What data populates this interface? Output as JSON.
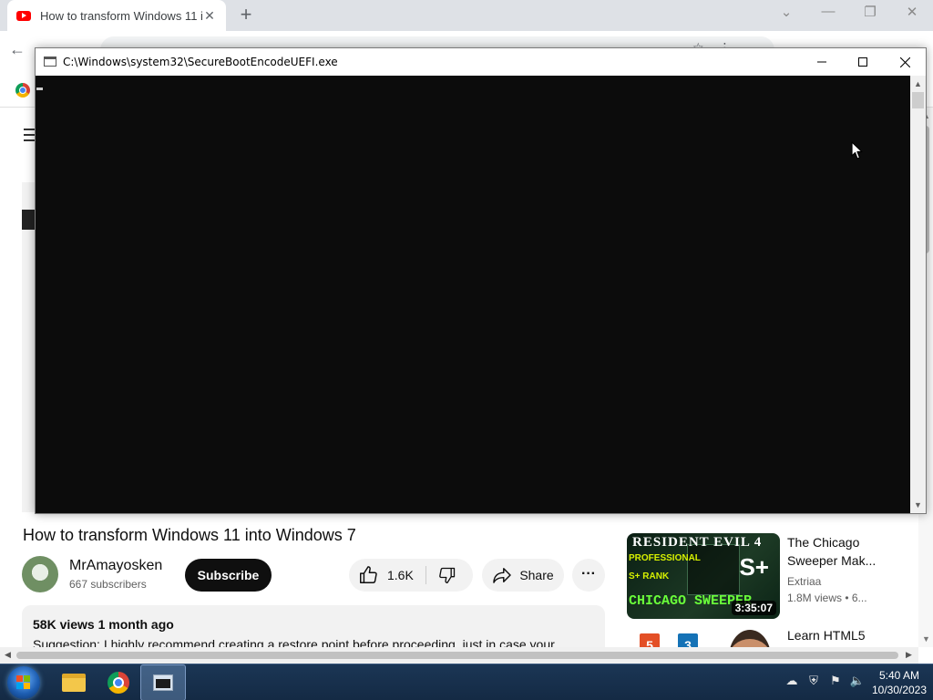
{
  "browser": {
    "tab_title": "How to transform Windows 11 i",
    "new_tab": "+",
    "page": {
      "video_title": "How to transform Windows 11 into Windows 7",
      "channel_name": "MrAmayosken",
      "subscribers": "667 subscribers",
      "subscribe_label": "Subscribe",
      "likes": "1.6K",
      "share_label": "Share",
      "more_label": "···",
      "description_meta": "58K views  1 month ago",
      "description_text": "Suggestion: I highly recommend creating a restore point before proceeding, just in case your"
    },
    "recommendations": [
      {
        "title": "The Chicago Sweeper Mak...",
        "channel": "Extriaa",
        "views": "1.8M views  • 6...",
        "duration": "3:35:07",
        "thumb_text": [
          "RESIDENT EVIL 4",
          "PROFESSIONAL",
          "S+ RANK",
          "CHICAGO SWEEPER",
          "S+"
        ]
      },
      {
        "title": "Learn HTML5",
        "thumb_text": [
          "5",
          "3"
        ]
      }
    ]
  },
  "console": {
    "title": "C:\\Windows\\system32\\SecureBootEncodeUEFI.exe",
    "background_color": "#0c0c0c"
  },
  "taskbar": {
    "time": "5:40 AM",
    "date": "10/30/2023",
    "apps": [
      "file-explorer",
      "google-chrome",
      "console"
    ]
  }
}
